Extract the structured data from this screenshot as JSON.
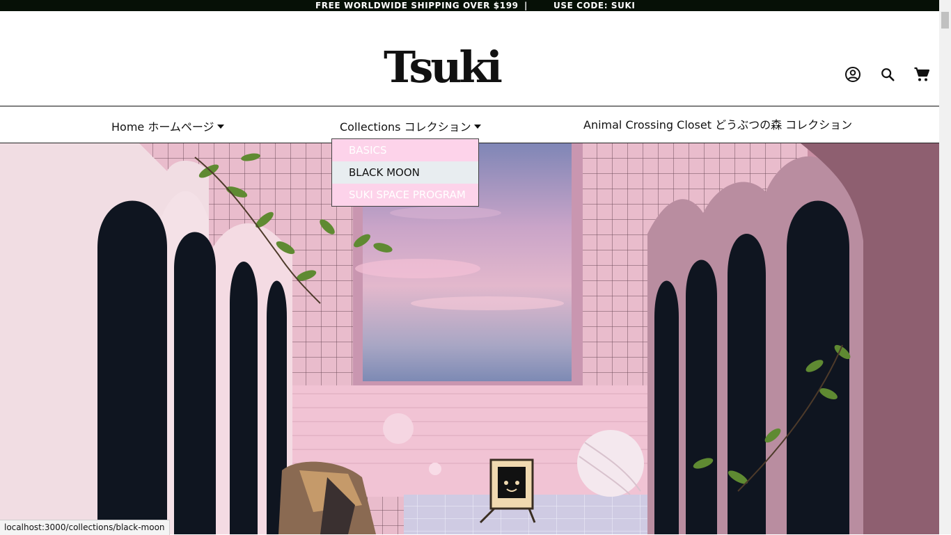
{
  "announcement": {
    "shipping": "FREE WORLDWIDE SHIPPING OVER $199",
    "separator": "|",
    "code": "USE CODE: SUKI"
  },
  "brand": {
    "logo": "Tsuki"
  },
  "header_icons": {
    "account": "account-circle-icon",
    "search": "search-icon",
    "cart": "cart-icon"
  },
  "nav": {
    "items": [
      {
        "label": "Home ホームページ"
      },
      {
        "label": "Collections コレクション"
      },
      {
        "label": "Animal Crossing Closet どうぶつの森 コレクション"
      }
    ]
  },
  "dropdown": {
    "items": [
      {
        "label": "BASICS"
      },
      {
        "label": "BLACK MOON"
      },
      {
        "label": "SUKI SPACE PROGRAM"
      }
    ]
  },
  "status_bar": {
    "url": "localhost:3000/collections/black-moon"
  },
  "colors": {
    "announcement_bg": "#061006",
    "dropdown_pink": "#fdd3ea",
    "dropdown_hover": "#e8edf0",
    "hero_pink": "#e2b8c6"
  }
}
